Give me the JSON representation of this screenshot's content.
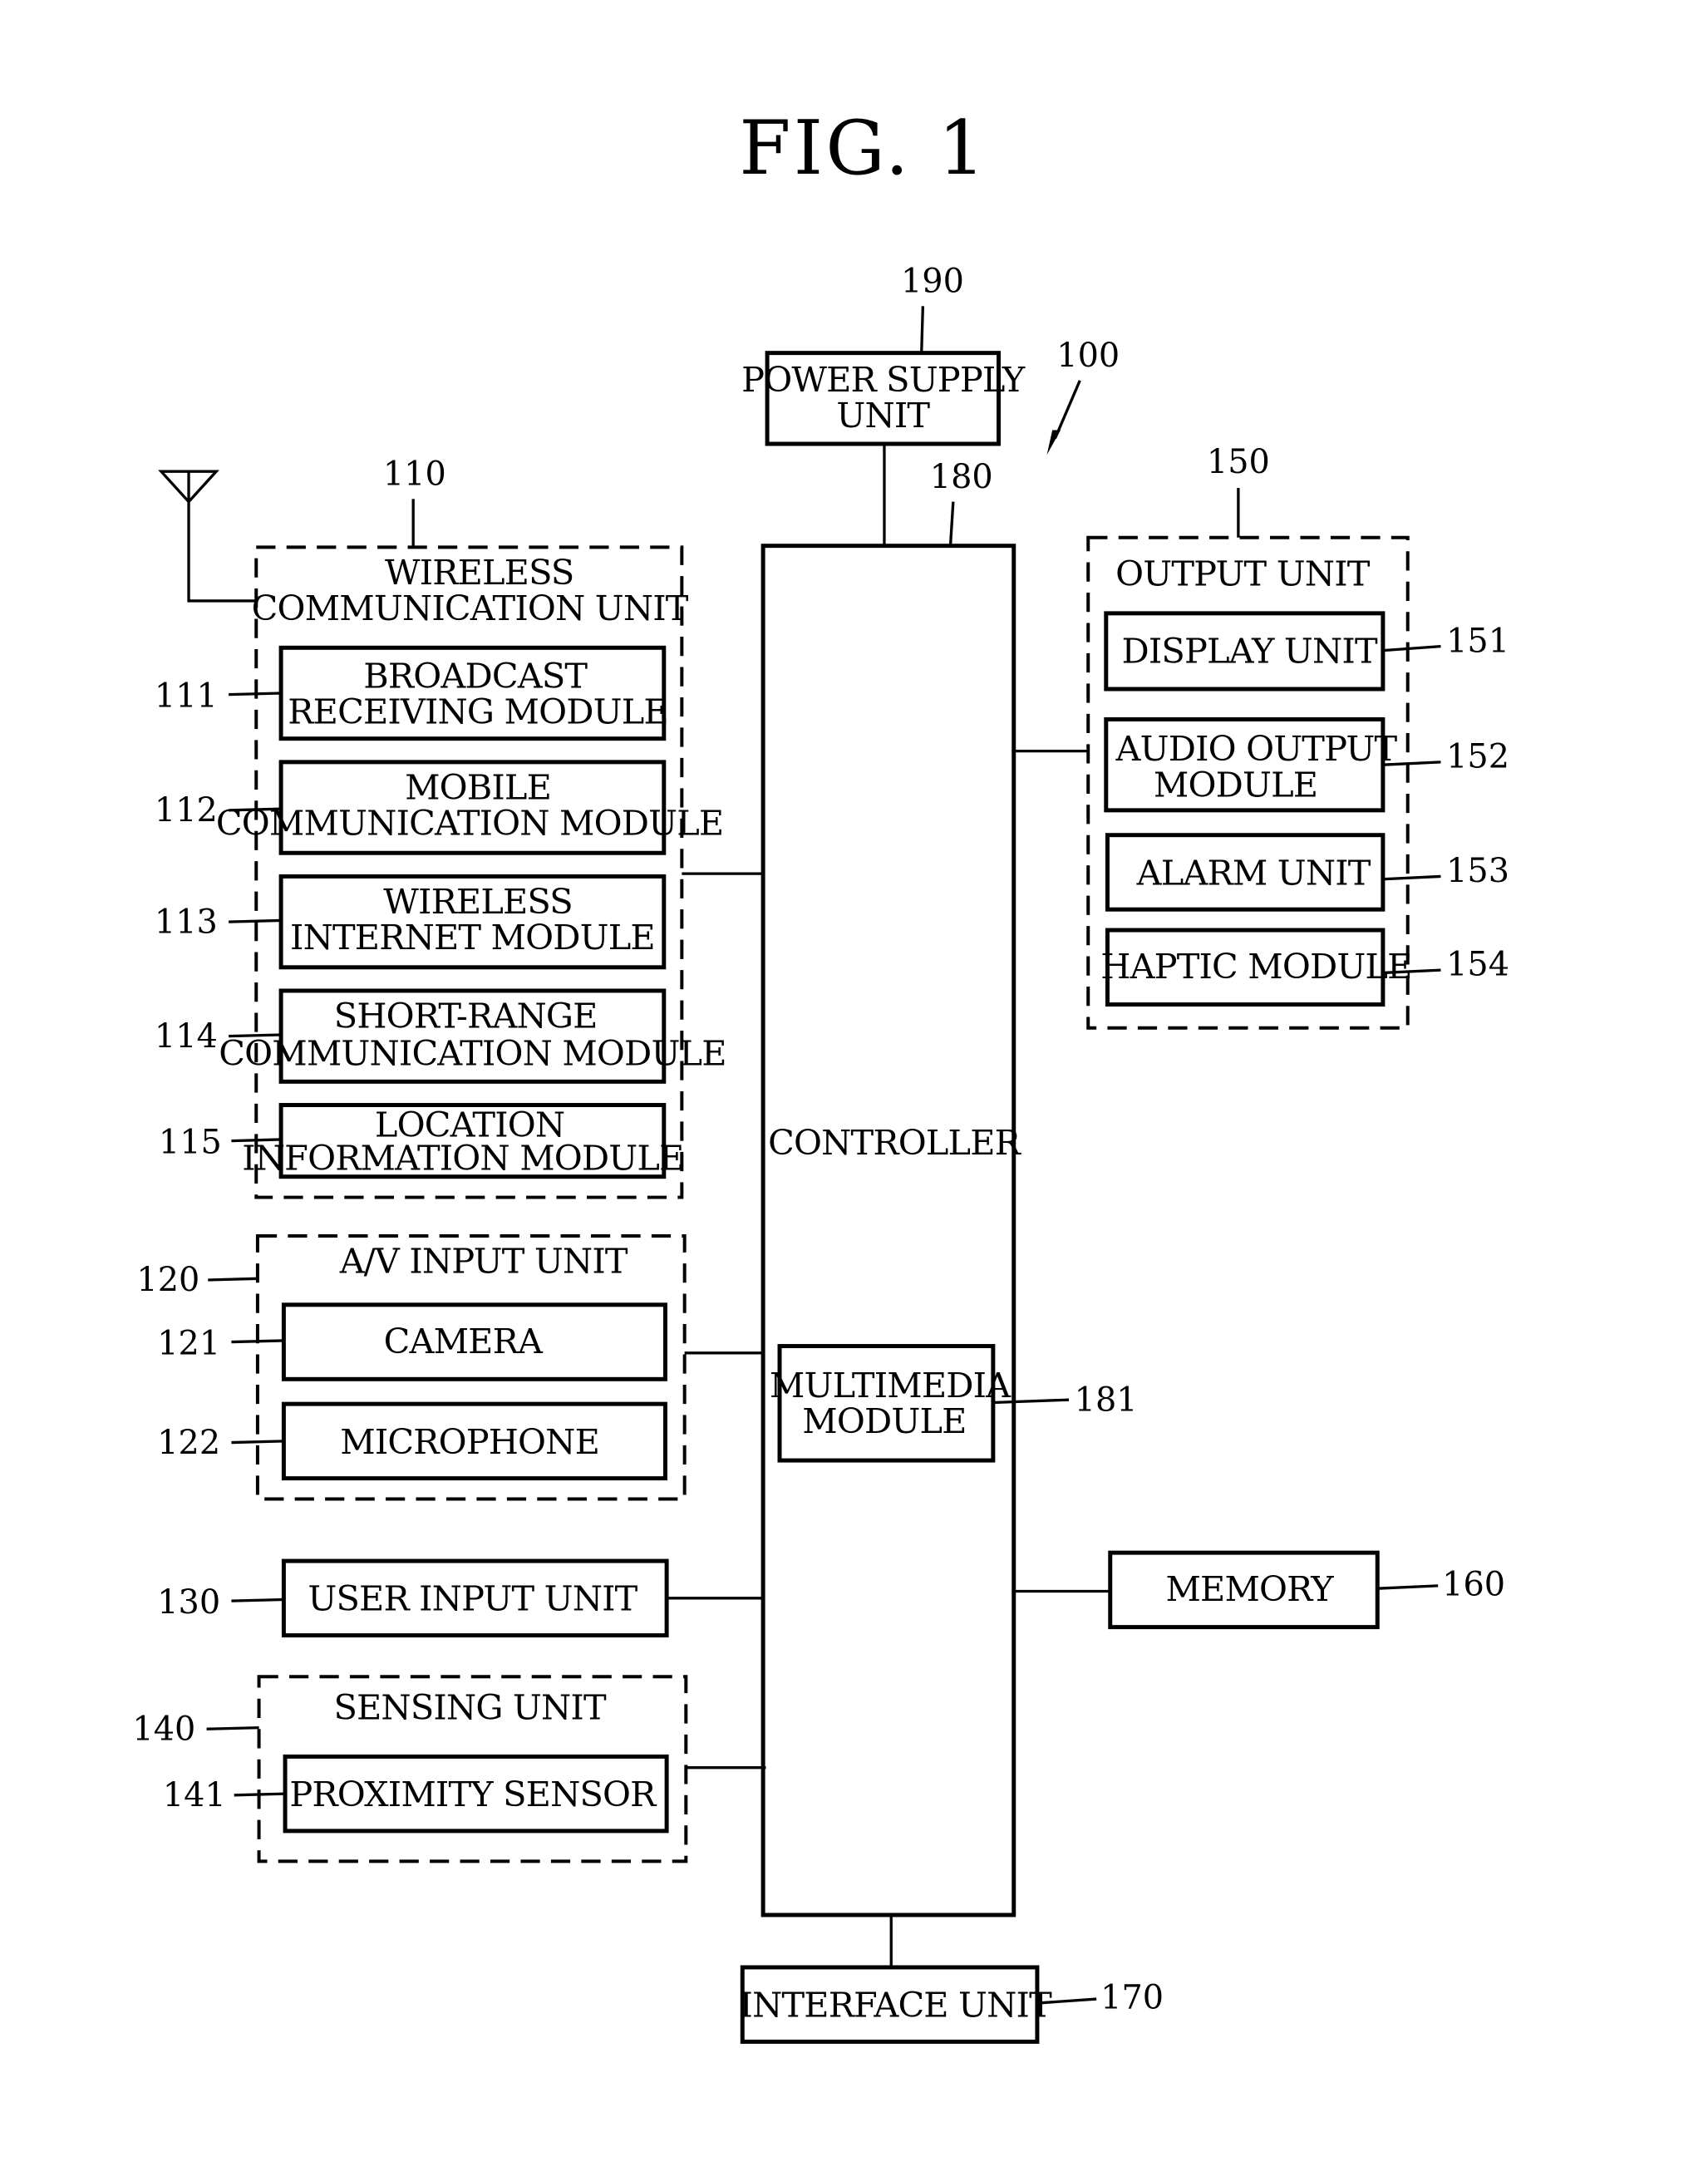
{
  "figure": {
    "title": "FIG. 1",
    "device_ref": "100"
  },
  "power_supply": {
    "ref": "190",
    "lines": [
      "POWER SUPPLY",
      "UNIT"
    ]
  },
  "controller": {
    "ref": "180",
    "label": "CONTROLLER",
    "multimedia": {
      "ref": "181",
      "lines": [
        "MULTIMEDIA",
        "MODULE"
      ]
    }
  },
  "wireless": {
    "ref": "110",
    "lines": [
      "WIRELESS",
      "COMMUNICATION UNIT"
    ],
    "modules": [
      {
        "ref": "111",
        "lines": [
          "BROADCAST",
          "RECEIVING MODULE"
        ]
      },
      {
        "ref": "112",
        "lines": [
          "MOBILE",
          "COMMUNICATION MODULE"
        ]
      },
      {
        "ref": "113",
        "lines": [
          "WIRELESS",
          "INTERNET MODULE"
        ]
      },
      {
        "ref": "114",
        "lines": [
          "SHORT-RANGE",
          "COMMUNICATION MODULE"
        ]
      },
      {
        "ref": "115",
        "lines": [
          "LOCATION",
          "INFORMATION MODULE"
        ]
      }
    ]
  },
  "av_input": {
    "ref": "120",
    "label": "A/V INPUT UNIT",
    "modules": [
      {
        "ref": "121",
        "label": "CAMERA"
      },
      {
        "ref": "122",
        "label": "MICROPHONE"
      }
    ]
  },
  "user_input": {
    "ref": "130",
    "label": "USER INPUT UNIT"
  },
  "sensing": {
    "ref": "140",
    "label": "SENSING UNIT",
    "modules": [
      {
        "ref": "141",
        "label": "PROXIMITY SENSOR"
      }
    ]
  },
  "output": {
    "ref": "150",
    "label": "OUTPUT UNIT",
    "modules": [
      {
        "ref": "151",
        "lines": [
          "DISPLAY UNIT"
        ]
      },
      {
        "ref": "152",
        "lines": [
          "AUDIO OUTPUT",
          "MODULE"
        ]
      },
      {
        "ref": "153",
        "lines": [
          "ALARM UNIT"
        ]
      },
      {
        "ref": "154",
        "lines": [
          "HAPTIC MODULE"
        ]
      }
    ]
  },
  "memory": {
    "ref": "160",
    "label": "MEMORY"
  },
  "interface": {
    "ref": "170",
    "label": "INTERFACE UNIT"
  }
}
